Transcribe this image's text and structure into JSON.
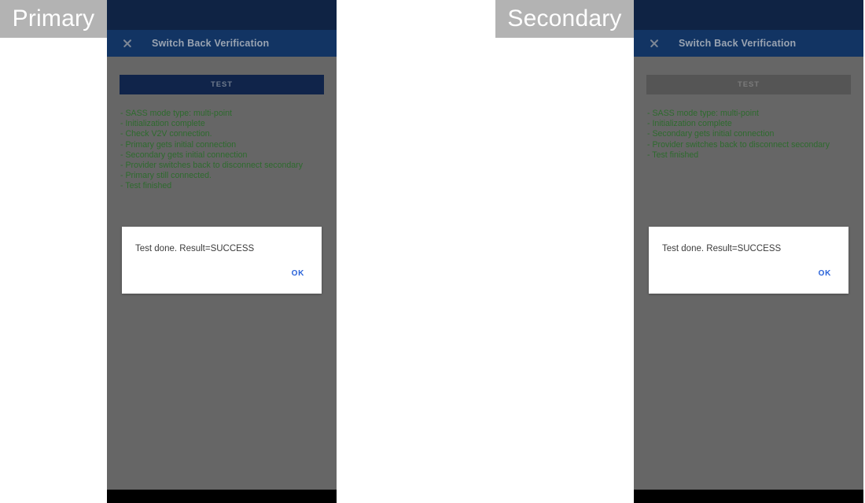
{
  "labels": {
    "primary": "Primary",
    "secondary": "Secondary"
  },
  "colors": {
    "statusbar": "#0f2344",
    "titlebar": "#123463",
    "scrim": "#666666",
    "log_text": "#2e6b2e",
    "button_enabled_bg": "#10244a",
    "button_disabled_bg": "#555555",
    "dialog_bg": "#ffffff",
    "ok_accent": "#2962d9",
    "label_badge": "#b3b3b3",
    "navbar": "#000000"
  },
  "panels": [
    {
      "id": "primary",
      "titlebar": {
        "close_icon": "close-icon",
        "title": "Switch Back Verification"
      },
      "test_button": {
        "label": "TEST",
        "state": "enabled"
      },
      "log_lines": [
        "- SASS mode type: multi-point",
        "- Initialization complete",
        "- Check V2V connection.",
        "- Primary gets initial connection",
        "- Secondary gets initial connection",
        "- Provider switches back to disconnect secondary",
        "- Primary still connected.",
        "- Test finished"
      ],
      "dialog": {
        "message": "Test done. Result=SUCCESS",
        "ok_label": "OK"
      }
    },
    {
      "id": "secondary",
      "titlebar": {
        "close_icon": "close-icon",
        "title": "Switch Back Verification"
      },
      "test_button": {
        "label": "TEST",
        "state": "disabled"
      },
      "log_lines": [
        "- SASS mode type: multi-point",
        "- Initialization complete",
        "- Secondary gets initial connection",
        "- Provider switches back to disconnect secondary",
        "- Test finished"
      ],
      "dialog": {
        "message": "Test done. Result=SUCCESS",
        "ok_label": "OK"
      }
    }
  ]
}
